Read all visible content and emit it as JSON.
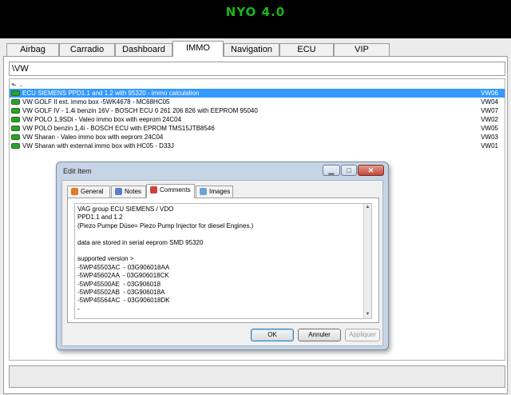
{
  "app": {
    "title": "NYO 4.0"
  },
  "tabs": [
    {
      "label": "Airbag"
    },
    {
      "label": "Carradio"
    },
    {
      "label": "Dashboard"
    },
    {
      "label": "IMMO"
    },
    {
      "label": "Navigation"
    },
    {
      "label": "ECU"
    },
    {
      "label": "VIP"
    }
  ],
  "active_tab": "IMMO",
  "path": "\\VW",
  "list": {
    "up_label": "..",
    "items": [
      {
        "text": "ECU SIEMENS PPD1.1 and 1.2 with 95320 - immo calculation",
        "code": "VW06",
        "selected": true
      },
      {
        "text": "VW GOLF II ext. immo box -5WK4678 - MC68HC05",
        "code": "VW04"
      },
      {
        "text": "VW GOLF IV - 1.4i benzin 16V - BOSCH ECU 0 261 206 826 with  EEPROM 95040",
        "code": "VW07"
      },
      {
        "text": "VW POLO 1,9SDi - Valeo immo box with eeprom 24C04",
        "code": "VW02"
      },
      {
        "text": "VW POLO benzin 1,4i - BOSCH ECU with  EPROM TMS15JTB8546",
        "code": "VW05"
      },
      {
        "text": "VW Sharan - Valeo immo box with eeprom 24C04",
        "code": "VW03"
      },
      {
        "text": "VW Sharan with external immo box with HC05 - D33J",
        "code": "VW01"
      }
    ]
  },
  "dialog": {
    "title": "Edit Item",
    "window_buttons": {
      "minimize": "▁",
      "maximize": "□",
      "close": "✕"
    },
    "tabs": [
      {
        "label": "General",
        "icon": "general-icon"
      },
      {
        "label": "Notes",
        "icon": "notes-icon"
      },
      {
        "label": "Comments",
        "icon": "comments-icon"
      },
      {
        "label": "Images",
        "icon": "images-icon"
      }
    ],
    "active_tab": "Comments",
    "comments": "VAG group ECU SIEMENS / VDO\nPPD1.1 and 1.2\n(Piezo Pumpe Düse= Piezo Pump Injector for diesel Engines.)\n\ndata are stored in serial eeprom SMD 95320\n\nsupported version >\n-5WP45503AC  - 03G906018AA\n-5WP45602AA  - 03G906018CK\n-5WP45500AE  - 03G906018\n-5WP45502AB  - 03G906018A\n-5WP45564AC  - 03G906018DK\n-",
    "buttons": {
      "ok": "OK",
      "cancel": "Annuler",
      "apply": "Appliquer"
    }
  },
  "colors": {
    "title_green": "#18b818",
    "selection": "#3399ff",
    "item_icon": "#2ea02e"
  }
}
